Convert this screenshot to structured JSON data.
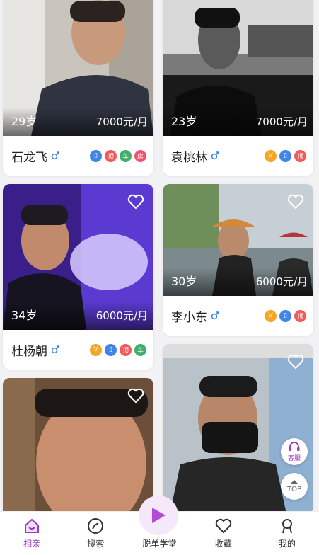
{
  "cards": [
    {
      "age": "29岁",
      "salary": "7000元/月",
      "name": "石龙飞",
      "badges": [
        {
          "label": "",
          "kind": "phone"
        },
        {
          "label": "顶",
          "kind": "top"
        },
        {
          "label": "车",
          "kind": "car"
        },
        {
          "label": "房",
          "kind": "house"
        }
      ]
    },
    {
      "age": "34岁",
      "salary": "6000元/月",
      "name": "杜杨朝",
      "badges": [
        {
          "label": "V",
          "kind": "v"
        },
        {
          "label": "",
          "kind": "phone"
        },
        {
          "label": "顶",
          "kind": "top"
        },
        {
          "label": "车",
          "kind": "car"
        }
      ]
    },
    {
      "age": "23岁",
      "salary": "7000元/月",
      "name": "袁桃林",
      "badges": [
        {
          "label": "V",
          "kind": "v"
        },
        {
          "label": "",
          "kind": "phone"
        },
        {
          "label": "顶",
          "kind": "top"
        }
      ]
    },
    {
      "age": "30岁",
      "salary": "6000元/月",
      "name": "李小东",
      "badges": [
        {
          "label": "V",
          "kind": "v"
        },
        {
          "label": "",
          "kind": "phone"
        },
        {
          "label": "顶",
          "kind": "top"
        }
      ]
    }
  ],
  "floating": {
    "service_label": "客服",
    "top_label": "TOP"
  },
  "tabs": [
    {
      "label": "相亲",
      "icon": "home-icon",
      "active": true
    },
    {
      "label": "搜索",
      "icon": "compass-icon",
      "active": false
    },
    {
      "label": "脱单学堂",
      "icon": "play-icon",
      "active": false
    },
    {
      "label": "收藏",
      "icon": "heart-icon",
      "active": false
    },
    {
      "label": "我的",
      "icon": "profile-icon",
      "active": false
    }
  ],
  "colors": {
    "accent": "#9a3cc4",
    "background": "#f2f2f4"
  }
}
